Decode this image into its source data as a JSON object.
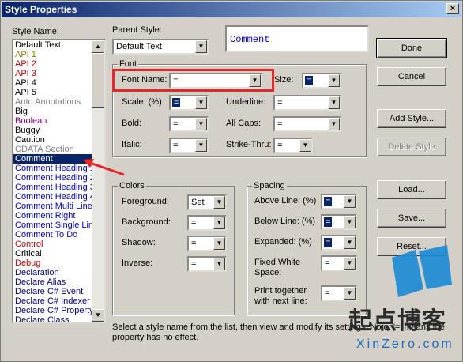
{
  "window": {
    "title": "Style Properties",
    "close_glyph": "×"
  },
  "style_name": {
    "label": "Style Name:",
    "items": [
      {
        "text": "Default Text",
        "color": "#000000"
      },
      {
        "text": "API 1",
        "color": "#808000"
      },
      {
        "text": "API 2",
        "color": "#c00000"
      },
      {
        "text": "API 3",
        "color": "#c00000"
      },
      {
        "text": "API 4",
        "color": "#000000"
      },
      {
        "text": "API 5",
        "color": "#000000"
      },
      {
        "text": "Auto Annotations",
        "color": "#808080"
      },
      {
        "text": "Big",
        "color": "#000000"
      },
      {
        "text": "Boolean",
        "color": "#800080"
      },
      {
        "text": "Buggy",
        "color": "#000000"
      },
      {
        "text": "Caution",
        "color": "#000000"
      },
      {
        "text": "CDATA Section",
        "color": "#808080"
      },
      {
        "text": "Comment",
        "color": "#ffffff",
        "selected": true
      },
      {
        "text": "Comment Heading 1",
        "color": "#0000c0"
      },
      {
        "text": "Comment Heading 2",
        "color": "#0000c0"
      },
      {
        "text": "Comment Heading 3",
        "color": "#0000c0"
      },
      {
        "text": "Comment Heading 4",
        "color": "#0000c0"
      },
      {
        "text": "Comment Multi Line",
        "color": "#0000c0"
      },
      {
        "text": "Comment Right",
        "color": "#0000c0"
      },
      {
        "text": "Comment Single Line",
        "color": "#0000c0"
      },
      {
        "text": "Comment To Do",
        "color": "#0000c0"
      },
      {
        "text": "Control",
        "color": "#c00000"
      },
      {
        "text": "Critical",
        "color": "#000000"
      },
      {
        "text": "Debug",
        "color": "#c00000"
      },
      {
        "text": "Declaration",
        "color": "#000080"
      },
      {
        "text": "Declare Alias",
        "color": "#000080"
      },
      {
        "text": "Declare C# Event",
        "color": "#000080"
      },
      {
        "text": "Declare C# Indexer",
        "color": "#000080"
      },
      {
        "text": "Declare C# Property",
        "color": "#000080"
      },
      {
        "text": "Declare Class",
        "color": "#000080"
      }
    ]
  },
  "parent_style": {
    "label": "Parent Style:",
    "value": "Default Text"
  },
  "preview": {
    "text": "Comment"
  },
  "font": {
    "title": "Font",
    "font_name": {
      "label": "Font Name:",
      "value": "="
    },
    "size": {
      "label": "Size:",
      "value": "="
    },
    "scale": {
      "label": "Scale: (%)",
      "value": "="
    },
    "underline": {
      "label": "Underline:",
      "value": "="
    },
    "bold": {
      "label": "Bold:",
      "value": "="
    },
    "all_caps": {
      "label": "All Caps:",
      "value": "="
    },
    "italic": {
      "label": "Italic:",
      "value": "="
    },
    "strike_thru": {
      "label": "Strike-Thru:",
      "value": "="
    }
  },
  "colors": {
    "title": "Colors",
    "foreground": {
      "label": "Foreground:",
      "value": "Set"
    },
    "background": {
      "label": "Background:",
      "value": "="
    },
    "shadow": {
      "label": "Shadow:",
      "value": "="
    },
    "inverse": {
      "label": "Inverse:",
      "value": "="
    }
  },
  "spacing": {
    "title": "Spacing",
    "above_line": {
      "label": "Above Line: (%)",
      "value": "="
    },
    "below_line": {
      "label": "Below Line: (%)",
      "value": "="
    },
    "expanded": {
      "label": "Expanded: (%)",
      "value": "="
    },
    "fixed_white_space": {
      "label1": "Fixed White",
      "label2": "Space:",
      "value": "="
    },
    "print_together": {
      "label1": "Print together",
      "label2": "with next line:",
      "value": "="
    }
  },
  "buttons": {
    "done": "Done",
    "cancel": "Cancel",
    "add_style": "Add Style...",
    "delete_style": "Delete Style",
    "load": "Load...",
    "save": "Save...",
    "reset": "Reset..."
  },
  "hint": {
    "line1": "Select a style name from the list, then view and modify its settings. Note: '=' means the",
    "line2": "property has no effect."
  },
  "watermark": {
    "brand": "起点博客",
    "site": "XinZero.com"
  },
  "colors_theme": {
    "dialog": "#d4d0c8",
    "selection": "#0a246a",
    "annotation": "#e8262a"
  }
}
